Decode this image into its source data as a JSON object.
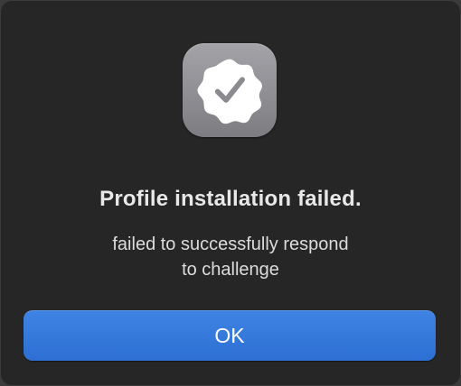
{
  "dialog": {
    "icon": "verified-badge-checkmark-icon",
    "title": "Profile installation failed.",
    "message_line1": "failed to successfully respond",
    "message_line2": "to challenge",
    "ok_label": "OK"
  },
  "colors": {
    "dialog_background": "#262626",
    "button_blue": "#3478e0",
    "icon_tile_gray": "#8e8e93"
  }
}
